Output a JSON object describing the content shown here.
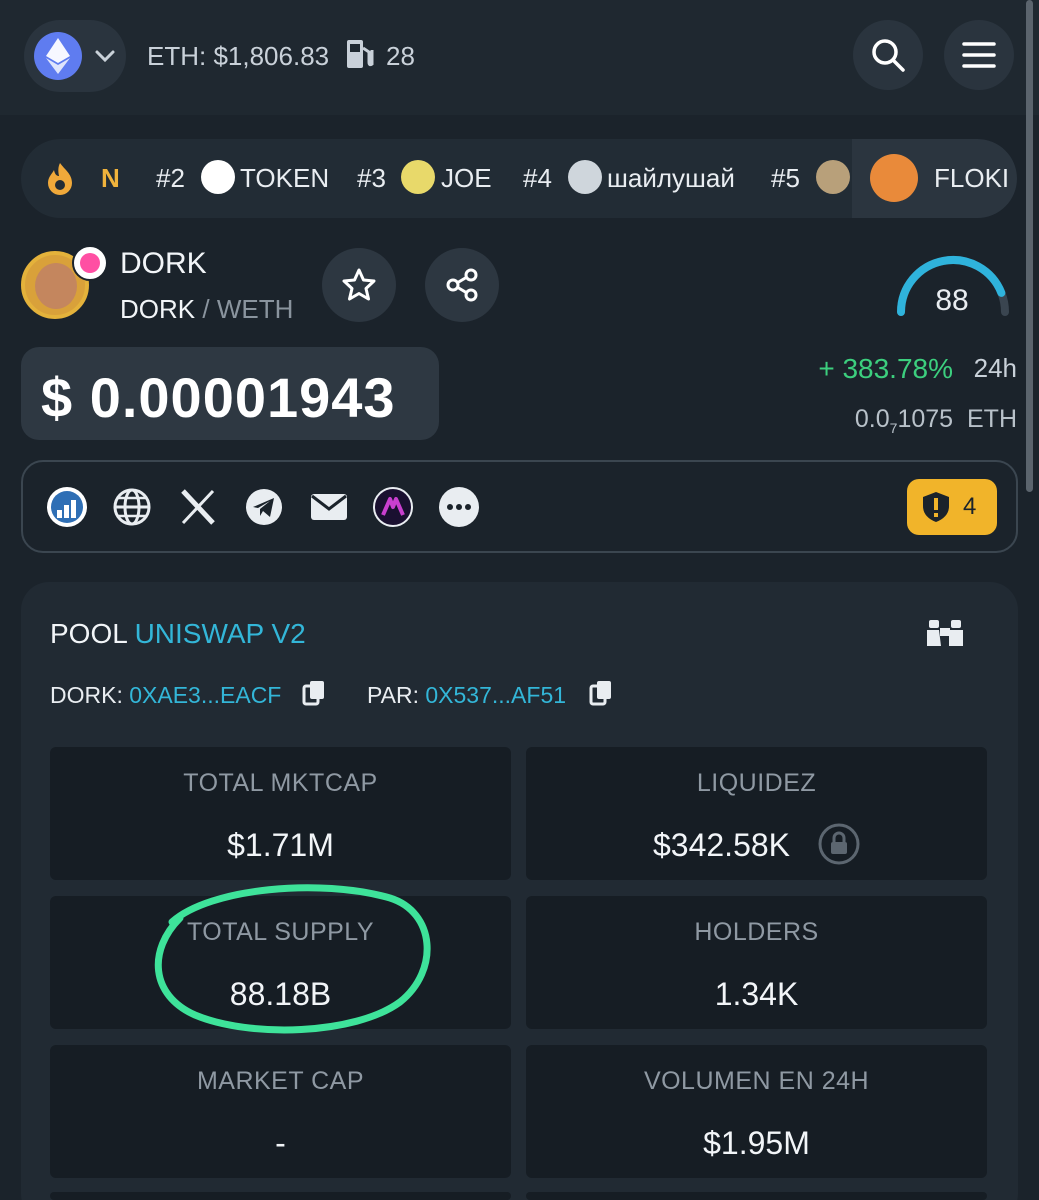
{
  "header": {
    "eth_price": "ETH: $1,806.83",
    "gas": "28"
  },
  "trending": {
    "items": [
      {
        "rank": "",
        "name": "N"
      },
      {
        "rank": "#2",
        "name": "TOKEN"
      },
      {
        "rank": "#3",
        "name": "JOE"
      },
      {
        "rank": "#4",
        "name": "шайлушай"
      },
      {
        "rank": "#5",
        "name": ""
      },
      {
        "rank": "",
        "name": "FLOKI"
      }
    ]
  },
  "token": {
    "name": "DORK",
    "base": "DORK",
    "separator": "/",
    "quote": "WETH",
    "score": "88",
    "score_fraction": 0.88,
    "price_usd": "$ 0.00001943",
    "change_24h": "+ 383.78%",
    "change_period": "24h",
    "price_eth_prefix": "0.0",
    "price_eth_zeros": "7",
    "price_eth_digits": "1075",
    "price_eth_unit": "ETH",
    "alerts": "4"
  },
  "pool": {
    "label": "POOL",
    "dex": "UNISWAP V2",
    "token_label": "DORK:",
    "token_address": "0XAE3...EACF",
    "pair_label": "PAR:",
    "pair_address": "0X537...AF51"
  },
  "stats": [
    {
      "label": "TOTAL MKTCAP",
      "value": "$1.71M"
    },
    {
      "label": "LIQUIDEZ",
      "value": "$342.58K"
    },
    {
      "label": "TOTAL SUPPLY",
      "value": "88.18B"
    },
    {
      "label": "HOLDERS",
      "value": "1.34K"
    },
    {
      "label": "MARKET CAP",
      "value": "-"
    },
    {
      "label": "VOLUMEN EN 24H",
      "value": "$1.95M"
    }
  ],
  "colors": {
    "background": "#1b232b",
    "accent_blue": "#33b6d8",
    "positive_green": "#3ccf7e",
    "warning_yellow": "#f1b42a",
    "annotation_green": "#3ee39a"
  }
}
